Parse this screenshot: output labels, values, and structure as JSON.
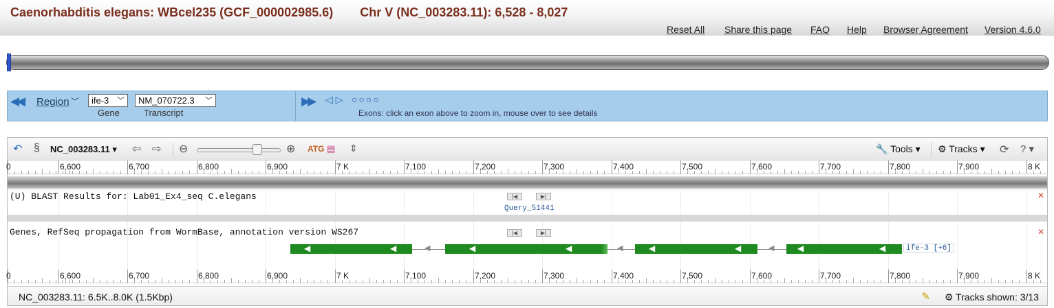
{
  "header": {
    "organism": "Caenorhabditis elegans:",
    "assembly": "WBcel235 (GCF_000002985.6)",
    "location": "Chr V (NC_003283.11):  6,528 - 8,027",
    "links": [
      "Reset All",
      "Share this page",
      "FAQ",
      "Help",
      "Browser Agreement",
      "Version 4.6.0"
    ]
  },
  "region_panel": {
    "region_label": "Region",
    "gene_select": "ife-3",
    "gene_label": "Gene",
    "transcript_select": "NM_070722.3",
    "transcript_label": "Transcript",
    "exon_hint": "Exons: click an exon above to zoom in, mouse over to see details"
  },
  "toolbar": {
    "seqid": "NC_003283.11",
    "tools_label": "Tools",
    "tracks_label": "Tracks"
  },
  "ruler": {
    "labels": [
      "0",
      "6,600",
      "6,700",
      "6,800",
      "6,900",
      "7 K",
      "7,100",
      "7,200",
      "7,300",
      "7,400",
      "7,500",
      "7,600",
      "7,700",
      "7,800",
      "7,900",
      "8 K"
    ]
  },
  "tracks": {
    "blast_label": "(U) BLAST Results for: Lab01_Ex4_seq C.elegans",
    "query_name": "Query_51441",
    "genes_label": "Genes, RefSeq propagation from WormBase, annotation version WS267",
    "gene_feature": "ife-3 [+6]"
  },
  "status": {
    "range": "NC_003283.11: 6.5K..8.0K (1.5Kbp)",
    "tracks_shown": "Tracks shown: 3/13"
  },
  "colors": {
    "title": "#7a2f1e",
    "panel_blue": "#a6cdeb",
    "exon_green": "#1f8a1f"
  }
}
